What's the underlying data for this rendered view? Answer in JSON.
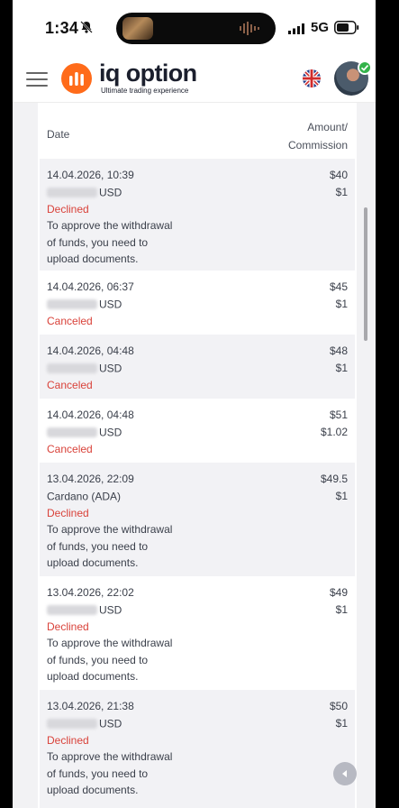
{
  "status_bar": {
    "time": "1:34",
    "network": "5G"
  },
  "header": {
    "brand": "iq option",
    "tagline": "Ultimate trading experience"
  },
  "table": {
    "col_date": "Date",
    "col_amount_line1": "Amount/",
    "col_amount_line2": "Commission",
    "rows": [
      {
        "date": "14.04.2026, 10:39",
        "asset": "USD",
        "status": "Declined",
        "note_lines": [
          "To approve the withdrawal",
          "of funds, you need to",
          "upload documents."
        ],
        "amount": "$40",
        "commission": "$1"
      },
      {
        "date": "14.04.2026, 06:37",
        "asset": "USD",
        "status": "Canceled",
        "note_lines": [],
        "amount": "$45",
        "commission": "$1"
      },
      {
        "date": "14.04.2026, 04:48",
        "asset": "USD",
        "status": "Canceled",
        "note_lines": [],
        "amount": "$48",
        "commission": "$1"
      },
      {
        "date": "14.04.2026, 04:48",
        "asset": "USD",
        "status": "Canceled",
        "note_lines": [],
        "amount": "$51",
        "commission": "$1.02"
      },
      {
        "date": "13.04.2026, 22:09",
        "asset": "Cardano (ADA)",
        "status": "Declined",
        "note_lines": [
          "To approve the withdrawal",
          "of funds, you need to",
          "upload documents."
        ],
        "amount": "$49.5",
        "commission": "$1"
      },
      {
        "date": "13.04.2026, 22:02",
        "asset": "USD",
        "status": "Declined",
        "note_lines": [
          "To approve the withdrawal",
          "of funds, you need to",
          "upload documents."
        ],
        "amount": "$49",
        "commission": "$1"
      },
      {
        "date": "13.04.2026, 21:38",
        "asset": "USD",
        "status": "Declined",
        "note_lines": [
          "To approve the withdrawal",
          "of funds, you need to",
          "upload documents."
        ],
        "amount": "$50",
        "commission": "$1"
      }
    ]
  },
  "colors": {
    "accent": "#ff6b1a",
    "status": "#d9423a",
    "verified": "#33b34a"
  },
  "icons": [
    "bell-slash-icon",
    "signal-icon",
    "battery-icon",
    "menu-icon",
    "uk-flag-icon",
    "verified-icon",
    "back-arrow-icon"
  ]
}
